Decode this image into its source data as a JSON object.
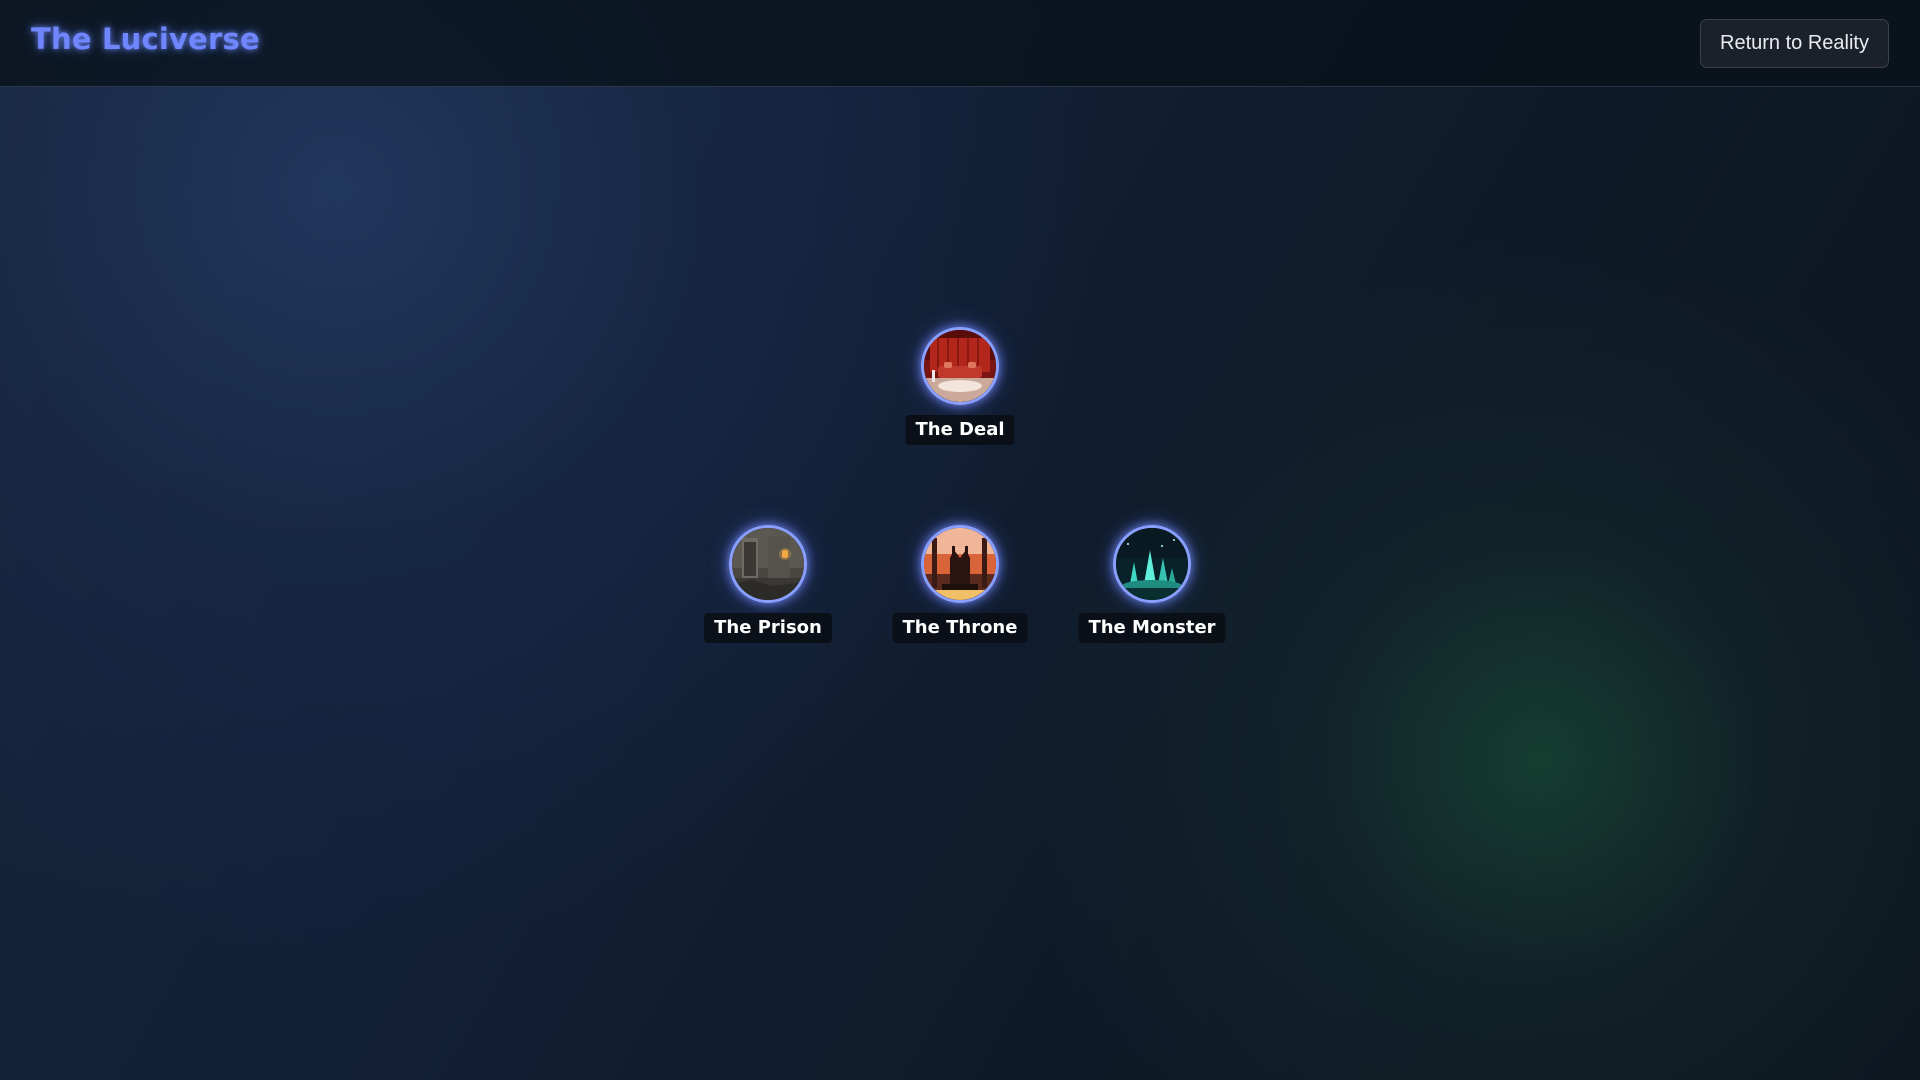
{
  "app": {
    "title": "The Luciverse"
  },
  "header": {
    "return_button_label": "Return to Reality"
  },
  "nodes": [
    {
      "label": "The Deal",
      "scene_icon": "red-curtain-room-icon"
    },
    {
      "label": "The Prison",
      "scene_icon": "stone-cell-icon"
    },
    {
      "label": "The Throne",
      "scene_icon": "sunset-throne-icon"
    },
    {
      "label": "The Monster",
      "scene_icon": "crystal-cavern-icon"
    }
  ],
  "colors": {
    "accent": "#6f86ff",
    "orb_ring": "#8aa0ff",
    "background": "#122038",
    "label_bg": "#0a0e14"
  }
}
